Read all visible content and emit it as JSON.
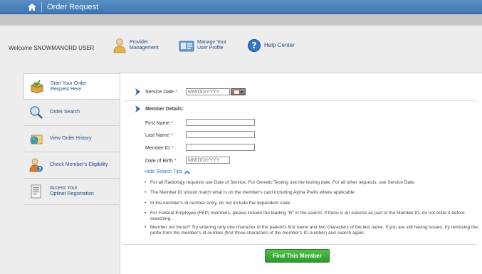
{
  "header": {
    "title": "Order Request",
    "home_icon": "home-icon"
  },
  "welcome": "Welcome SNOWMANORD USER",
  "utility": [
    {
      "line1": "Provider",
      "line2": "Management",
      "icon": "provider-icon"
    },
    {
      "line1": "Manage Your",
      "line2": "User Profile",
      "icon": "profile-icon"
    },
    {
      "line1": "Help Center",
      "icon": "help-icon"
    }
  ],
  "nav": [
    {
      "line1": "Start Your Order",
      "line2": "Request Here",
      "icon": "order-box-icon",
      "active": true
    },
    {
      "line1": "Order Search",
      "line2": "",
      "icon": "magnifier-icon"
    },
    {
      "line1": "View Order History",
      "line2": "",
      "icon": "history-icon"
    },
    {
      "line1": "Check Member's Eligibility",
      "line2": "",
      "icon": "eligibility-icon"
    },
    {
      "line1": "Access Your",
      "line2": "Optinet Registration",
      "icon": "registration-icon"
    }
  ],
  "form": {
    "service_date_label": "Service Date",
    "service_date_placeholder": "MM/DD/YYYY",
    "required_mark": "*",
    "member_details_label": "Member Details:",
    "first_name_label": "First Name",
    "last_name_label": "Last Name",
    "member_id_label": "Member ID",
    "dob_label": "Date of Birth",
    "dob_placeholder": "MM/DD/YYYY",
    "tips_toggle": "Hide Search Tips",
    "tips": [
      "For all Radiology requests use Date of Service. For Genetic Testing use the testing date. For all other requests, use Service Date.",
      "The Member ID should match what is on the member's card including Alpha Prefix where applicable.",
      "In the member's id number entry, do not include the dependent code.",
      "For Federal Employee (FEP) members, please include the leading \"R\" in the search. If there is an asterisk as part of the Member ID, do not enter it before searching.",
      "Member not found? Try entering only one character of the patient's first name and two characters of the last name. If you are still having issues, try removing the prefix from the member's id number (first three characters of the member's ID number) and search again."
    ],
    "submit": "Find This Member"
  },
  "colors": {
    "topbar": "#4a82bf",
    "link": "#1f4c86",
    "button": "#3aab36",
    "required": "#c0392b"
  }
}
